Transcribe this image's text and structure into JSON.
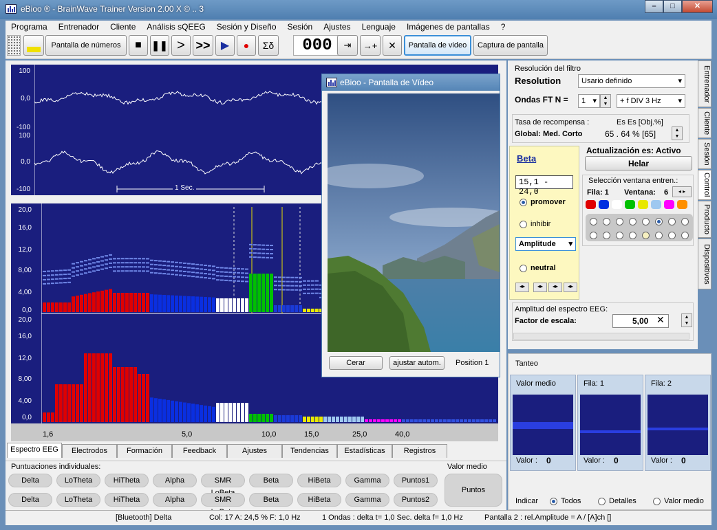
{
  "window": {
    "title": "eBioo ® - BrainWave Trainer Version 2.00 X  © .. 3"
  },
  "menu": [
    "Programa",
    "Entrenador",
    "Cliente",
    "Análisis sQEEG",
    "Sesión y Diseño",
    "Sesión",
    "Ajustes",
    "Lenguaje",
    "Imágenes de pantallas",
    "?"
  ],
  "toolbar": {
    "numbers_btn": "Pantalla de números",
    "counter": "000",
    "video_btn": "Pantalla de video",
    "capture_btn": "Captura de pantalla",
    "sigma_label": "Σδ"
  },
  "eeg": {
    "ylabels_top": [
      "100",
      "0,0",
      "-100"
    ],
    "ylabels_bottom": [
      "100",
      "0,0",
      "-100"
    ],
    "scale_label": "1 Sec."
  },
  "spectrum": {
    "ylabels_top": [
      "20,0",
      "16,0",
      "12,0",
      "8,00",
      "4,00",
      "0,0"
    ],
    "ylabels_bottom": [
      "20,0",
      "16,0",
      "12,0",
      "8,00",
      "4,00",
      "0,0"
    ],
    "xlabels": [
      "1,6",
      "5,0",
      "10,0",
      "15,0",
      "25,0",
      "40,0"
    ]
  },
  "tabs": [
    "Espectro EEG",
    "Electrodos",
    "Formación",
    "Feedback",
    "Ajustes",
    "Tendencias",
    "Estadísticas",
    "Registros"
  ],
  "scores": {
    "title": "Puntuaciones individuales:",
    "row1": [
      "Delta",
      "LoTheta",
      "HiTheta",
      "Alpha",
      "SMR LoBeta",
      "Beta",
      "HiBeta",
      "Gamma",
      "Puntos1"
    ],
    "row2": [
      "Delta",
      "LoTheta",
      "HiTheta",
      "Alpha",
      "SMR LoBeta",
      "Beta",
      "HiBeta",
      "Gamma",
      "Puntos2"
    ],
    "mean_title": "Valor medio",
    "mean_btn": "Puntos"
  },
  "video": {
    "title": "eBioo - Pantalla de Vídeo",
    "close_btn": "Cerar",
    "auto_btn": "ajustar autom.",
    "position": "Position 1"
  },
  "filter": {
    "section": "Resolución del filtro",
    "resolution_label": "Resolution",
    "resolution_value": "Usario definido",
    "waves_label": "Ondas FT N =",
    "waves_value": "1",
    "fdiv": "+ f DIV  3 Hz"
  },
  "reward": {
    "section": "Tasa de recompensa :",
    "es_header": "Es Es [Obj.%]",
    "global_label": "Global: Med. Corto",
    "global_value": "65 . 64 % [65]"
  },
  "band": {
    "name": "Beta",
    "range": "15,1  - 24,0",
    "promote": "promover",
    "inhibit": "inhibir",
    "mode": "Amplitude",
    "neutral": "neutral"
  },
  "update": {
    "label": "Actualización es: Activo",
    "btn": "Helar"
  },
  "window_sel": {
    "section": "Selección ventana entren.:",
    "row_label": "Fila: 1",
    "win_label": "Ventana:",
    "win_value": "6"
  },
  "chips": [
    "#e00000",
    "#0030e0",
    "#ffffff",
    "#00c000",
    "#e8e800",
    "#9ec8f0",
    "#ff00ff",
    "#ff9000"
  ],
  "amplitude": {
    "section": "Amplitud del espectro EEG:",
    "factor_label": "Factor de escala:",
    "factor_value": "5,00"
  },
  "side_tabs": [
    "Entrenador",
    "Cliente",
    "Sesión",
    "Control",
    "Producto",
    "Dispositivos"
  ],
  "tanteo": {
    "title": "Tanteo",
    "panels": [
      {
        "label": "Valor medio",
        "val_label": "Valor :",
        "value": "0"
      },
      {
        "label": "Fila: 1",
        "val_label": "Valor :",
        "value": "0"
      },
      {
        "label": "Fila: 2",
        "val_label": "Valor :",
        "value": "0"
      }
    ],
    "indicate": "Indicar",
    "opt_all": "Todos",
    "opt_details": "Detalles",
    "opt_mean": "Valor medio"
  },
  "status": {
    "bt": "[Bluetooth]  Delta",
    "col": "Col: 17  A:  24,5 %  F:  1,0 Hz",
    "waves": "1 Ondas : delta t= 1,0 Sec. delta f= 1,0 Hz",
    "screen": "Pantalla 2 :  rel.Amplitude = A / [A]ch  []"
  }
}
